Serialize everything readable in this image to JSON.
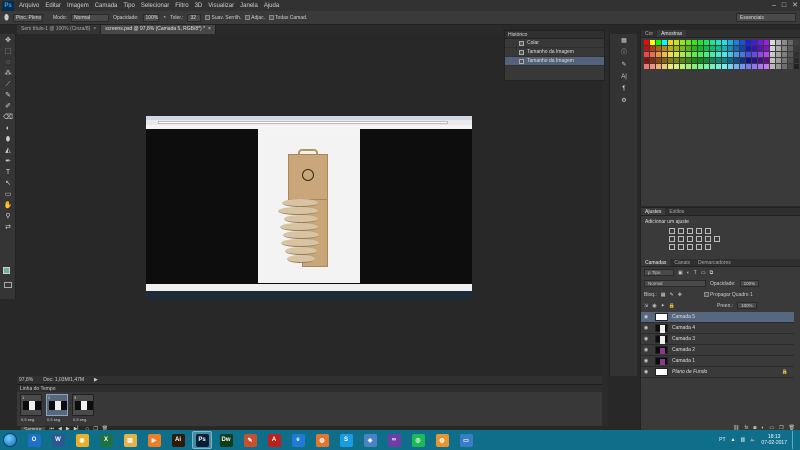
{
  "app": {
    "logo": "Ps",
    "title": "Adobe Photoshop CS6"
  },
  "menu": [
    "Arquivo",
    "Editar",
    "Imagem",
    "Camada",
    "Tipo",
    "Selecionar",
    "Filtro",
    "3D",
    "Visualizar",
    "Janela",
    "Ajuda"
  ],
  "window_controls": {
    "minimize": "–",
    "maximize": "□",
    "close": "✕"
  },
  "options_bar": {
    "brush_preset": "Pinc. Pleno",
    "mode_label": "Modo:",
    "mode_value": "Normal",
    "opacity_label": "Opacidade:",
    "opacity_value": "100%",
    "tolerance_label": "Toler.:",
    "tolerance_value": "32",
    "antialias_label": "Suav. Serrilh.",
    "contiguous_label": "Adjac.",
    "all_layers_label": "Todas Camad.",
    "workspace": "Essenciais"
  },
  "doc_tabs": [
    {
      "label": "Sem título-1 @ 100% (Cinza/8)",
      "active": false
    },
    {
      "label": "screens.psd @ 97,8% (Camada 5, RGB/8*) *",
      "active": true
    }
  ],
  "tools": [
    "✥",
    "⬚",
    "◌",
    "⁂",
    "⟋",
    "✎",
    "✐",
    "⌫",
    "◐",
    "⬮",
    "◭",
    "✒",
    "T",
    "↖",
    "▭",
    "✋",
    "⚲",
    "⇄"
  ],
  "history": {
    "title": "Histórico",
    "items": [
      {
        "label": "Colar",
        "selected": false
      },
      {
        "label": "Tamanho da Imagem",
        "selected": false
      },
      {
        "label": "Tamanho da Imagem",
        "selected": true
      }
    ]
  },
  "swatch_panel": {
    "tabs": [
      "Cor",
      "Amostras"
    ],
    "active": "Amostras"
  },
  "adjust_panel": {
    "tabs": [
      "Ajustes",
      "Estilos"
    ],
    "heading": "Adicionar um ajuste"
  },
  "layers_panel": {
    "tabs": [
      "Camadas",
      "Canais",
      "Demarcadores"
    ],
    "kind_filter": "ρ Tipo",
    "blend_mode": "Normal",
    "opacity_label": "Opacidade:",
    "opacity_value": "100%",
    "lock_label": "Bloq.:",
    "propagate_label": "Propagar Quadro 1",
    "fill_label": "Preen.:",
    "fill_value": "100%",
    "layers": [
      {
        "name": "Camada 5",
        "thumb": "white",
        "selected": true
      },
      {
        "name": "Camada 4",
        "thumb": "doc",
        "selected": false
      },
      {
        "name": "Camada 3",
        "thumb": "doc",
        "selected": false
      },
      {
        "name": "Camada 2",
        "thumb": "magenta",
        "selected": false
      },
      {
        "name": "Camada 1",
        "thumb": "magenta",
        "selected": false
      },
      {
        "name": "Plano de Fundo",
        "thumb": "plain",
        "selected": false,
        "locked": true
      }
    ],
    "footer_icons": [
      "link-icon",
      "fx-icon",
      "mask-icon",
      "adjustment-icon",
      "folder-icon",
      "new-layer-icon",
      "trash-icon"
    ]
  },
  "status": {
    "zoom": "97,8%",
    "doc_size": "Doc: 1,03M/1,47M"
  },
  "timeline": {
    "title": "Linha do Tempo",
    "frames": [
      {
        "num": "1",
        "delay": "0,5 seg.",
        "selected": false
      },
      {
        "num": "2",
        "delay": "0,5 seg.",
        "selected": true
      },
      {
        "num": "3",
        "delay": "0,5 seg.",
        "selected": false
      }
    ],
    "loop": "Sempre"
  },
  "taskbar": {
    "apps": [
      {
        "name": "outlook",
        "glyph": "O",
        "color": "#1e6fc8"
      },
      {
        "name": "word",
        "glyph": "W",
        "color": "#2b5797"
      },
      {
        "name": "chrome",
        "glyph": "◉",
        "color": "#e9b22a"
      },
      {
        "name": "excel",
        "glyph": "X",
        "color": "#1e7145"
      },
      {
        "name": "explorer",
        "glyph": "▤",
        "color": "#e3b24a"
      },
      {
        "name": "media",
        "glyph": "▶",
        "color": "#ef7d22"
      },
      {
        "name": "illustrator",
        "glyph": "Ai",
        "color": "#2e1a08"
      },
      {
        "name": "photoshop",
        "glyph": "Ps",
        "color": "#061e36",
        "active": true
      },
      {
        "name": "dreamweaver",
        "glyph": "Dw",
        "color": "#0f3d17"
      },
      {
        "name": "paint",
        "glyph": "✎",
        "color": "#c94f2d"
      },
      {
        "name": "acrobat",
        "glyph": "A",
        "color": "#c0201c"
      },
      {
        "name": "edge",
        "glyph": "e",
        "color": "#1f7bd6"
      },
      {
        "name": "app-orange",
        "glyph": "◍",
        "color": "#e3762e"
      },
      {
        "name": "skype",
        "glyph": "S",
        "color": "#1d9be0"
      },
      {
        "name": "app-blue",
        "glyph": "◈",
        "color": "#4a83c3"
      },
      {
        "name": "visual-studio",
        "glyph": "∞",
        "color": "#6b3fa6"
      },
      {
        "name": "spotify",
        "glyph": "◎",
        "color": "#1db954"
      },
      {
        "name": "app-orange-2",
        "glyph": "◍",
        "color": "#e8952d"
      },
      {
        "name": "app-window",
        "glyph": "▭",
        "color": "#3a7dc7"
      }
    ],
    "tray_lang": "PT",
    "time": "18:13",
    "date": "07-02-2017"
  }
}
